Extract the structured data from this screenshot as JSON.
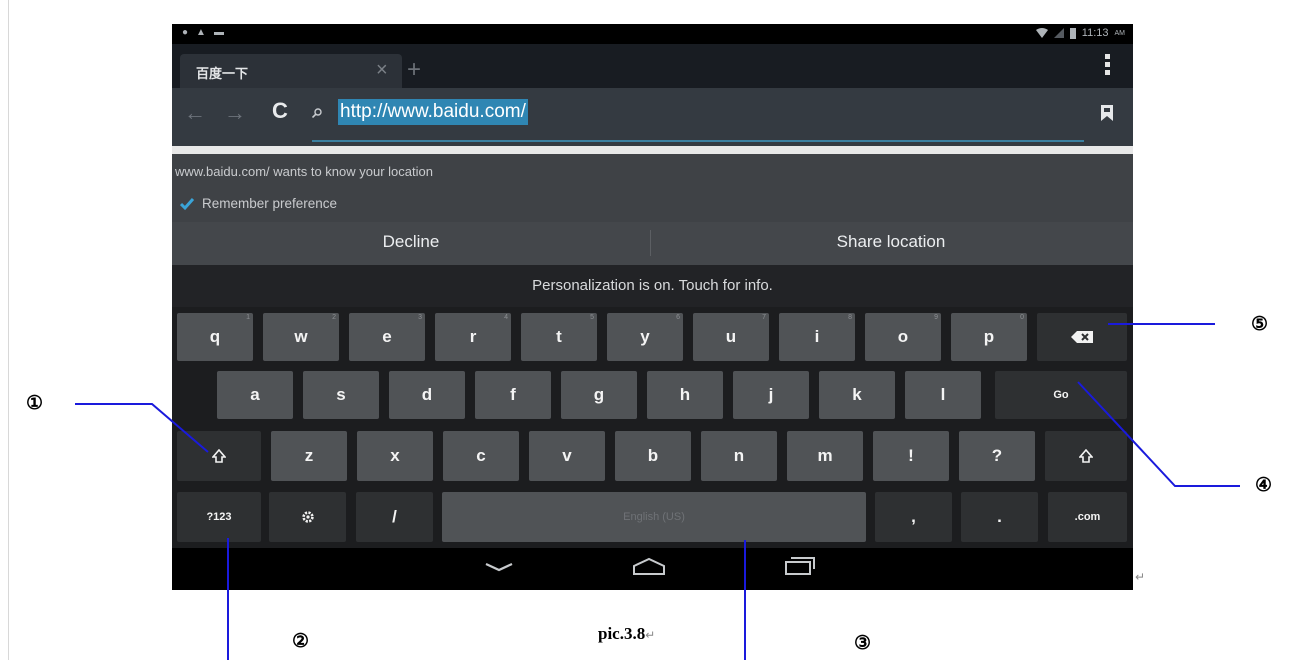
{
  "status_bar": {
    "time": "11:13",
    "ampm": "AM"
  },
  "browser": {
    "tab_title": "百度一下",
    "tab_close": "×",
    "new_tab": "+",
    "back": "←",
    "forward": "→",
    "reload": "C",
    "url": "http://www.baidu.com/"
  },
  "permission": {
    "message": "www.baidu.com/ wants to know your location",
    "remember_label": "Remember preference",
    "decline_label": "Decline",
    "share_label": "Share location"
  },
  "keyboard": {
    "banner": "Personalization is on. Touch for info.",
    "row1": [
      {
        "label": "q",
        "hint": "1"
      },
      {
        "label": "w",
        "hint": "2"
      },
      {
        "label": "e",
        "hint": "3"
      },
      {
        "label": "r",
        "hint": "4"
      },
      {
        "label": "t",
        "hint": "5"
      },
      {
        "label": "y",
        "hint": "6"
      },
      {
        "label": "u",
        "hint": "7"
      },
      {
        "label": "i",
        "hint": "8"
      },
      {
        "label": "o",
        "hint": "9"
      },
      {
        "label": "p",
        "hint": "0"
      }
    ],
    "row2": [
      "a",
      "s",
      "d",
      "f",
      "g",
      "h",
      "j",
      "k",
      "l"
    ],
    "go_label": "Go",
    "row3": [
      "z",
      "x",
      "c",
      "v",
      "b",
      "n",
      "m",
      "!",
      "?"
    ],
    "symbols_label": "?123",
    "slash_label": "/",
    "space_label": "English (US)",
    "comma_label": ",",
    "period_label": ".",
    "dotcom_label": ".com"
  },
  "annotations": {
    "c1": "①",
    "c2": "②",
    "c3": "③",
    "c4": "④",
    "c5": "⑤",
    "caption": "pic.3.8",
    "return_mark": "↵"
  },
  "colors": {
    "accent": "#2f86b3",
    "callout_line": "#1a1adc"
  }
}
